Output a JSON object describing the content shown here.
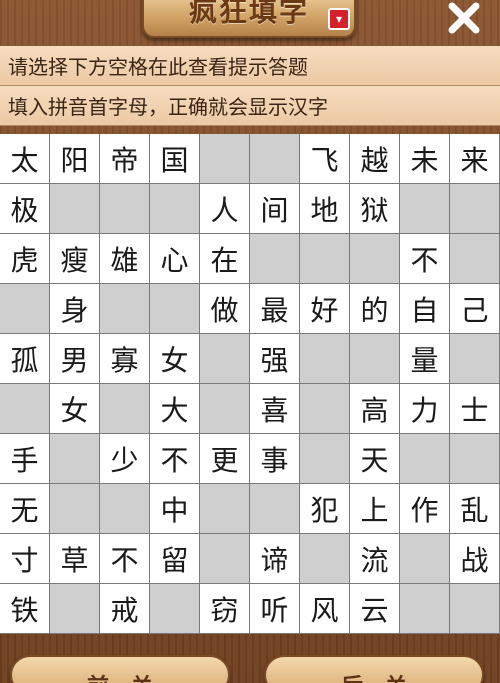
{
  "header": {
    "title": "疯狂填字",
    "ribbon_icon": "bookmark-ribbon-icon",
    "close_icon": "close-icon"
  },
  "info": {
    "line1": "请选择下方空格在此查看提示答题",
    "line2": "填入拼音首字母，正确就会显示汉字"
  },
  "grid": {
    "rows": [
      [
        "太",
        "阳",
        "帝",
        "国",
        "",
        "",
        "飞",
        "越",
        "未",
        "来"
      ],
      [
        "极",
        "",
        "",
        "",
        "人",
        "间",
        "地",
        "狱",
        "",
        ""
      ],
      [
        "虎",
        "瘦",
        "雄",
        "心",
        "在",
        "",
        "",
        "",
        "不",
        ""
      ],
      [
        "",
        "身",
        "",
        "",
        "做",
        "最",
        "好",
        "的",
        "自",
        "己"
      ],
      [
        "孤",
        "男",
        "寡",
        "女",
        "",
        "强",
        "",
        "",
        "量",
        ""
      ],
      [
        "",
        "女",
        "",
        "大",
        "",
        "喜",
        "",
        "高",
        "力",
        "士"
      ],
      [
        "手",
        "",
        "少",
        "不",
        "更",
        "事",
        "",
        "天",
        "",
        ""
      ],
      [
        "无",
        "",
        "",
        "中",
        "",
        "",
        "犯",
        "上",
        "作",
        "乱"
      ],
      [
        "寸",
        "草",
        "不",
        "留",
        "",
        "谛",
        "",
        "流",
        "",
        "战"
      ],
      [
        "铁",
        "",
        "戒",
        "",
        "窃",
        "听",
        "风",
        "云",
        "",
        ""
      ]
    ],
    "blanks": [
      [
        0,
        0,
        0,
        0,
        1,
        1,
        0,
        0,
        0,
        0
      ],
      [
        0,
        1,
        1,
        1,
        0,
        0,
        0,
        0,
        1,
        1
      ],
      [
        0,
        0,
        0,
        0,
        0,
        1,
        1,
        1,
        0,
        1
      ],
      [
        1,
        0,
        1,
        1,
        0,
        0,
        0,
        0,
        0,
        0
      ],
      [
        0,
        0,
        0,
        0,
        1,
        0,
        1,
        1,
        0,
        1
      ],
      [
        1,
        0,
        1,
        0,
        1,
        0,
        1,
        0,
        0,
        0
      ],
      [
        0,
        1,
        0,
        0,
        0,
        0,
        1,
        0,
        1,
        1
      ],
      [
        0,
        1,
        1,
        0,
        1,
        1,
        0,
        0,
        0,
        0
      ],
      [
        0,
        0,
        0,
        0,
        1,
        0,
        1,
        0,
        1,
        0
      ],
      [
        0,
        1,
        0,
        1,
        0,
        0,
        0,
        0,
        1,
        1
      ]
    ]
  },
  "buttons": {
    "prev_label": "前一关",
    "next_label": "后一关"
  },
  "colors": {
    "blank_cell": "#cfcfcf",
    "letter_cell": "#ffffff",
    "wood": "#7a4a2a",
    "info_bar": "#f6dcc0"
  }
}
